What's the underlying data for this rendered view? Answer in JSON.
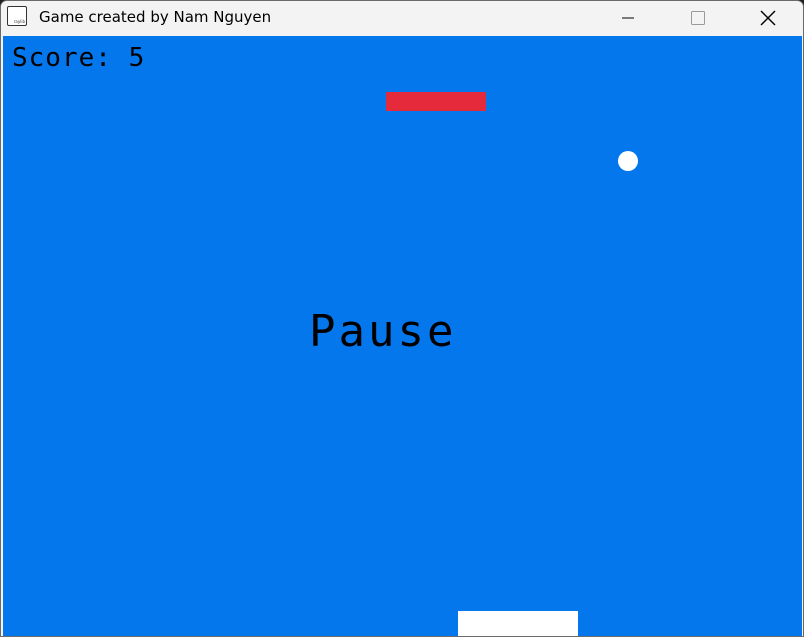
{
  "window": {
    "title": "Game created by Nam Nguyen",
    "icon": "raylib-icon",
    "icon_text": "raylib",
    "controls": [
      "minimize-icon",
      "maximize-icon",
      "close-icon"
    ]
  },
  "game": {
    "background_color": "#0577ec",
    "score_text": "Score: 5",
    "status_text": "Pause",
    "brick_color": "#e52b3b",
    "ball_color": "#ffffff",
    "paddle_color": "#ffffff"
  }
}
